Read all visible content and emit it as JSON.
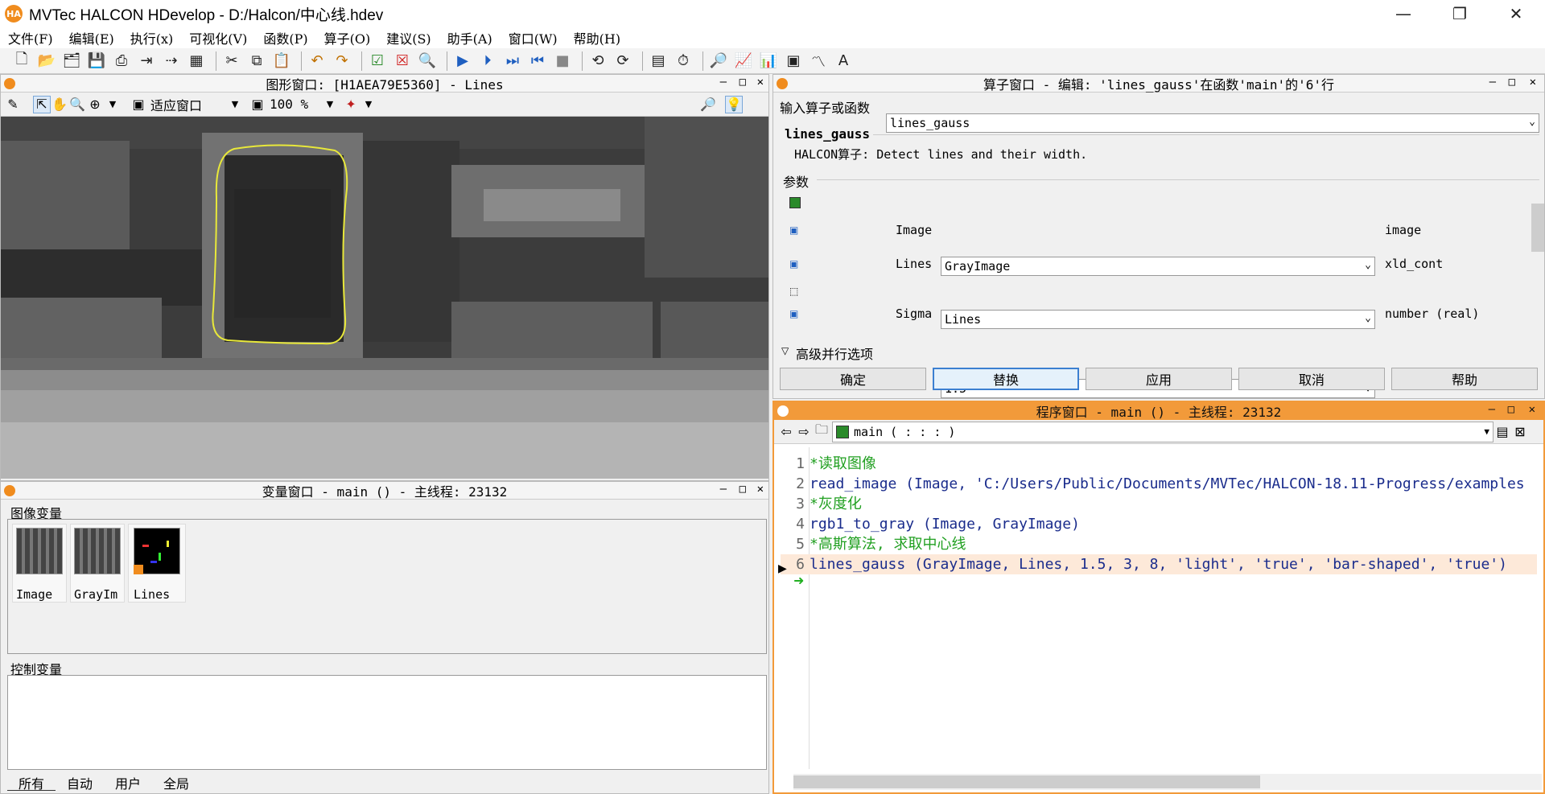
{
  "window": {
    "title": "MVTec HALCON HDevelop - D:/Halcon/中心线.hdev",
    "logo": "HA",
    "min": "—",
    "max": "❐",
    "close": "✕"
  },
  "menu": [
    "文件(F)",
    "编辑(E)",
    "执行(x)",
    "可视化(V)",
    "函数(P)",
    "算子(O)",
    "建议(S)",
    "助手(A)",
    "窗口(W)",
    "帮助(H)"
  ],
  "graphics": {
    "title": "图形窗口: [H1AEA79E5360] - Lines",
    "fit_label": "适应窗口",
    "zoom": "100 %"
  },
  "operator": {
    "title": "算子窗口 - 编辑: 'lines_gauss'在函数'main'的'6'行",
    "input_label": "输入算子或函数",
    "input_value": "lines_gauss",
    "name": "lines_gauss",
    "desc": "HALCON算子: Detect lines and their width.",
    "params_label": "参数",
    "params": [
      {
        "name": "Image",
        "value": "GrayImage",
        "type": "image"
      },
      {
        "name": "Lines",
        "value": "Lines",
        "type": "xld_cont"
      },
      {
        "name": "Sigma",
        "value": "1.5",
        "type": "number (real)"
      }
    ],
    "advanced": "高级并行选项",
    "buttons": [
      "确定",
      "替换",
      "应用",
      "取消",
      "帮助"
    ]
  },
  "program": {
    "title": "程序窗口 - main () - 主线程: 23132",
    "procedure": "main ( : : : )",
    "lines": [
      {
        "n": "1",
        "text": "*读取图像",
        "cls": "c-cmt"
      },
      {
        "n": "2",
        "text": "read_image (Image, 'C:/Users/Public/Documents/MVTec/HALCON-18.11-Progress/examples",
        "cls": "c-kw"
      },
      {
        "n": "3",
        "text": "*灰度化",
        "cls": "c-cmt"
      },
      {
        "n": "4",
        "text": "rgb1_to_gray (Image, GrayImage)",
        "cls": "c-kw"
      },
      {
        "n": "5",
        "text": "*高斯算法, 求取中心线",
        "cls": "c-cmt"
      },
      {
        "n": "6",
        "text": "lines_gauss (GrayImage, Lines, 1.5, 3, 8, 'light', 'true', 'bar-shaped', 'true')",
        "cls": "c-kw"
      }
    ]
  },
  "variables": {
    "title": "变量窗口 - main () - 主线程: 23132",
    "iconic_label": "图像变量",
    "control_label": "控制变量",
    "iconic": [
      "Image",
      "GrayIm",
      "Lines"
    ],
    "tabs": [
      "所有",
      "自动",
      "用户",
      "全局"
    ]
  }
}
